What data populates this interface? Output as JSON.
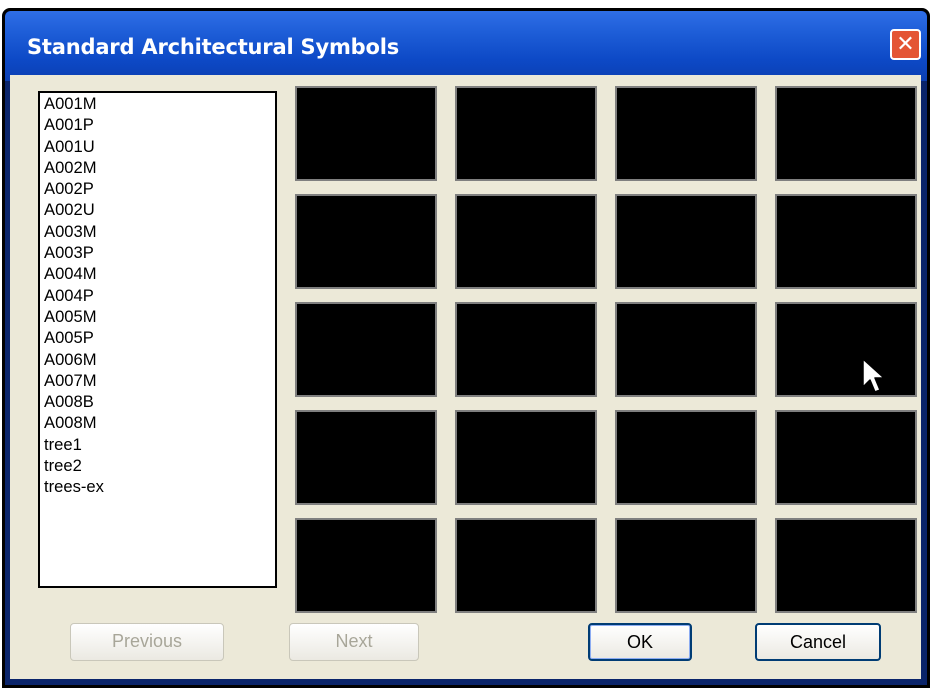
{
  "window": {
    "title": "Standard Architectural Symbols",
    "close_glyph": "✕"
  },
  "symbols": [
    "A001M",
    "A001P",
    "A001U",
    "A002M",
    "A002P",
    "A002U",
    "A003M",
    "A003P",
    "A004M",
    "A004P",
    "A005M",
    "A005P",
    "A006M",
    "A007M",
    "A008B",
    "A008M",
    "tree1",
    "tree2",
    "trees-ex"
  ],
  "preview_grid": {
    "rows": 5,
    "cols": 4
  },
  "buttons": {
    "previous": "Previous",
    "next": "Next",
    "ok": "OK",
    "cancel": "Cancel"
  },
  "colors": {
    "title_bar": "#1e5ed8",
    "close": "#e45534",
    "dialog_bg": "#ece9d8",
    "preview_bg": "#000000"
  }
}
